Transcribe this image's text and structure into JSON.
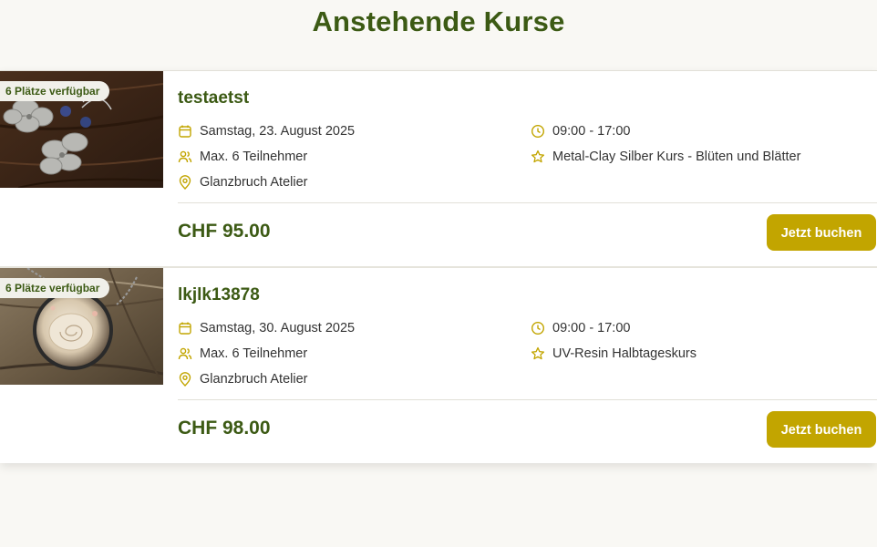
{
  "page": {
    "title": "Anstehende Kurse"
  },
  "courses": [
    {
      "badge": "6 Plätze verfügbar",
      "title": "testaetst",
      "date": "Samstag, 23. August 2025",
      "time": "09:00 - 17:00",
      "participants": "Max. 6 Teilnehmer",
      "course_type": "Metal-Clay Silber Kurs - Blüten und Blätter",
      "location": "Glanzbruch Atelier",
      "price": "CHF 95.00",
      "book_label": "Jetzt buchen",
      "image": "silver-flower-earrings-photo"
    },
    {
      "badge": "6 Plätze verfügbar",
      "title": "lkjlk13878",
      "date": "Samstag, 30. August 2025",
      "time": "09:00 - 17:00",
      "participants": "Max. 6 Teilnehmer",
      "course_type": "UV-Resin Halbtageskurs",
      "location": "Glanzbruch Atelier",
      "price": "CHF 98.00",
      "book_label": "Jetzt buchen",
      "image": "resin-shell-pendant-photo"
    }
  ],
  "icons": {
    "date": "calendar-icon",
    "time": "clock-icon",
    "participants": "users-icon",
    "course_type": "star-icon",
    "location": "map-pin-icon"
  },
  "colors": {
    "background": "#f9f8f4",
    "heading": "#3c5a14",
    "accent": "#c2a500",
    "text": "#333333"
  }
}
